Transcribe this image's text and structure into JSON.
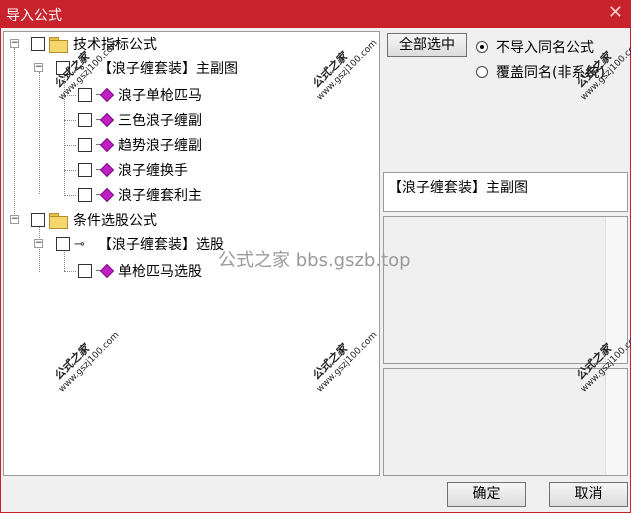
{
  "window": {
    "title": "导入公式",
    "close_glyph": "✕"
  },
  "tree": {
    "nodes": [
      {
        "label": "技术指标公式",
        "icon": "folder-icon",
        "level": 0
      },
      {
        "label": "【浪子缠套装】主副图",
        "icon": "key-icon",
        "level": 1,
        "selected": true
      },
      {
        "label": "浪子单枪匹马",
        "icon": "diamond-icon",
        "level": 2
      },
      {
        "label": "三色浪子缠副",
        "icon": "diamond-icon",
        "level": 2
      },
      {
        "label": "趋势浪子缠副",
        "icon": "diamond-icon",
        "level": 2
      },
      {
        "label": "浪子缠换手",
        "icon": "diamond-icon",
        "level": 2
      },
      {
        "label": "浪子缠套利主",
        "icon": "diamond-icon",
        "level": 2
      },
      {
        "label": "条件选股公式",
        "icon": "folder-icon",
        "level": 0
      },
      {
        "label": "【浪子缠套装】选股",
        "icon": "key-icon",
        "level": 1
      },
      {
        "label": "单枪匹马选股",
        "icon": "diamond-icon",
        "level": 2
      }
    ],
    "expander_minus": "−",
    "key_glyph": "⊸"
  },
  "options": {
    "select_all_label": "全部选中",
    "radio_skip_label": "不导入同名公式",
    "radio_overwrite_label": "覆盖同名(非系统)",
    "selected_radio": "skip"
  },
  "info": {
    "selected_name": "【浪子缠套装】主副图"
  },
  "buttons": {
    "ok_label": "确定",
    "cancel_label": "取消"
  },
  "watermarks": {
    "brand": "公式之家",
    "url": "www.gszj100.com",
    "center_text": "公式之家 bbs.gszb.top"
  }
}
